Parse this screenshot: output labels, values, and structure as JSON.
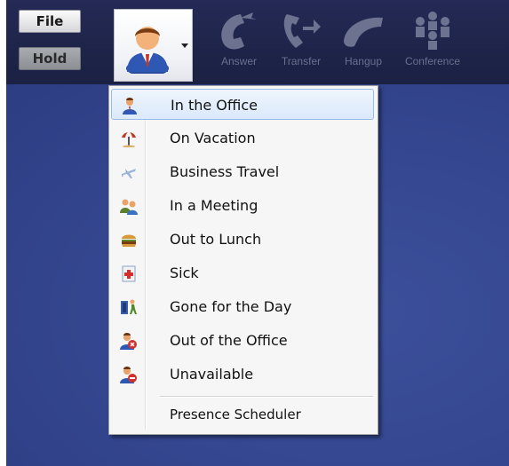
{
  "toolbar": {
    "file_label": "File",
    "hold_label": "Hold",
    "presence_icon": "user-icon",
    "tools": [
      {
        "label": "Answer",
        "icon": "phone-answer-icon"
      },
      {
        "label": "Transfer",
        "icon": "phone-transfer-icon"
      },
      {
        "label": "Hangup",
        "icon": "phone-hangup-icon"
      },
      {
        "label": "Conference",
        "icon": "conference-icon"
      }
    ]
  },
  "presence_menu": {
    "selected_index": 0,
    "items": [
      {
        "label": "In the Office",
        "icon": "person-in-office-icon"
      },
      {
        "label": "On Vacation",
        "icon": "beach-umbrella-icon"
      },
      {
        "label": "Business Travel",
        "icon": "airplane-icon"
      },
      {
        "label": "In a Meeting",
        "icon": "meeting-people-icon"
      },
      {
        "label": "Out to Lunch",
        "icon": "burger-icon"
      },
      {
        "label": "Sick",
        "icon": "first-aid-icon"
      },
      {
        "label": "Gone for the Day",
        "icon": "walking-out-icon"
      },
      {
        "label": "Out of the Office",
        "icon": "person-out-icon"
      },
      {
        "label": "Unavailable",
        "icon": "person-unavailable-icon"
      }
    ],
    "scheduler_label": "Presence Scheduler"
  },
  "colors": {
    "toolbar_bg": "#1e2449",
    "desktop_bg": "#35458d",
    "menu_highlight_border": "#97bbe6",
    "disabled_label": "#6a6f8e"
  }
}
